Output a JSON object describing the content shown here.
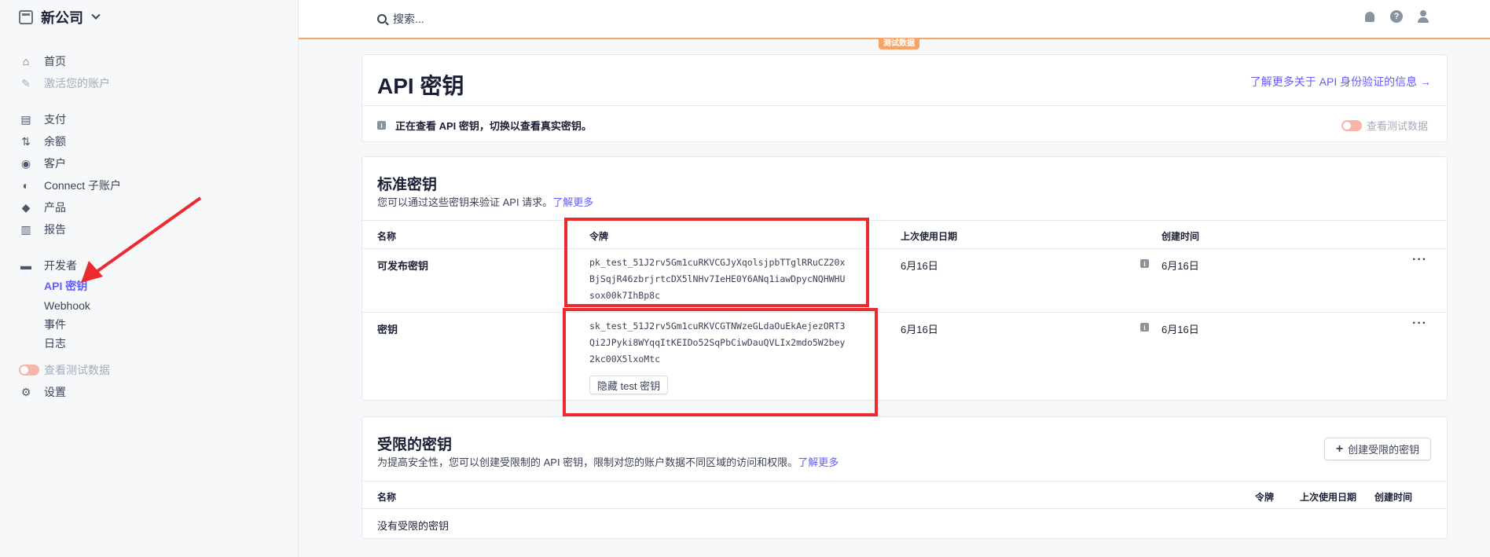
{
  "sidebar": {
    "company": "新公司",
    "items": [
      {
        "label": "首页",
        "icon": "home-icon"
      },
      {
        "label": "激活您的账户",
        "icon": "edit-icon"
      },
      {
        "label": "支付",
        "icon": "payments-icon"
      },
      {
        "label": "余额",
        "icon": "balance-icon"
      },
      {
        "label": "客户",
        "icon": "customer-icon"
      },
      {
        "label": "Connect 子账户",
        "icon": "connect-icon"
      },
      {
        "label": "产品",
        "icon": "product-icon"
      },
      {
        "label": "报告",
        "icon": "report-icon"
      },
      {
        "label": "开发者",
        "icon": "terminal-icon"
      }
    ],
    "dev_sub": [
      "API 密钥",
      "Webhook",
      "事件",
      "日志"
    ],
    "test_data_label": "查看测试数据",
    "settings_label": "设置"
  },
  "topbar": {
    "search_placeholder": "搜索...",
    "test_badge": "测试数据"
  },
  "api_card": {
    "title": "API 密钥",
    "learn_link": "了解更多关于 API 身份验证的信息 →",
    "notice": "正在查看 API 密钥，切换以查看真实密钥。",
    "toggle_label": "查看测试数据"
  },
  "standard": {
    "title": "标准密钥",
    "desc": "您可以通过这些密钥来验证 API 请求。",
    "learn_more": "了解更多",
    "columns": [
      "名称",
      "令牌",
      "上次使用日期",
      "创建时间"
    ],
    "rows": [
      {
        "name": "可发布密钥",
        "token_lines": [
          "pk_test_51J2rv5Gm1cuRKVCGJyXqolsjpbTTglRRuCZ20x",
          "BjSqjR46zbrjrtcDX5lNHv7IeHE0Y6ANq1iawDpycNQHWHU",
          "sox00k7IhBp8c"
        ],
        "last_used": "6月16日",
        "created": "6月16日"
      },
      {
        "name": "密钥",
        "token_lines": [
          "sk_test_51J2rv5Gm1cuRKVCGTNWzeGLdaOuEkAejezORT3",
          "Qi2JPyki8WYqqItKEIDo52SqPbCiwDauQVLIx2mdo5W2bey",
          "2kc00X5lxoMtc"
        ],
        "hide_button": "隐藏 test 密钥",
        "last_used": "6月16日",
        "created": "6月16日"
      }
    ]
  },
  "restricted": {
    "title": "受限的密钥",
    "desc": "为提高安全性，您可以创建受限制的 API 密钥，限制对您的账户数据不同区域的访问和权限。",
    "learn_more": "了解更多",
    "create_button": "创建受限的密钥",
    "columns": [
      "名称",
      "令牌",
      "上次使用日期",
      "创建时间"
    ],
    "empty": "没有受限的密钥"
  },
  "colors": {
    "accent": "#635bff",
    "test_orange": "#f5a56a",
    "highlight_red": "#ec2a2f"
  }
}
